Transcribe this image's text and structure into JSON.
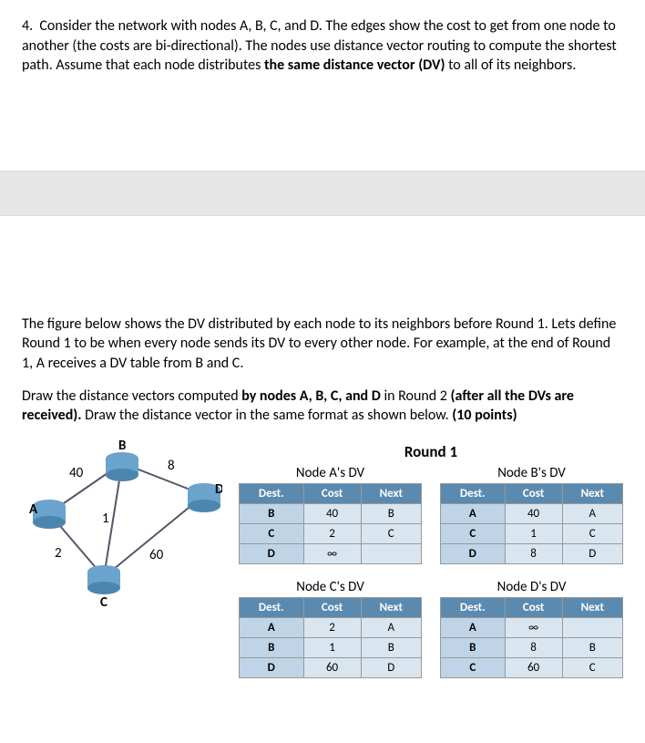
{
  "q_num": "4.",
  "q_p1a": "Consider the network with nodes A, B, C, and D. The edges show the cost to get from one node to another (the costs are bi-directional). The nodes use distance vector routing to compute the shortest path. Assume that each node distributes ",
  "q_p1b": "the same distance vector (DV)",
  "q_p1c": " to all of its neighbors.",
  "q_p2": "The figure below shows the DV distributed by each node to its neighbors before Round 1. Lets define Round 1 to be when every node sends its DV to every other node. For example, at the end of Round 1, A receives a DV table from B and C.",
  "q_p3a": "Draw the distance vectors computed ",
  "q_p3b": "by nodes A, B, C, and D",
  "q_p3c": " in Round 2 ",
  "q_p3d": "(after all the DVs are received).",
  "q_p3e": " Draw the distance vector in the same format as shown below. ",
  "q_p3f": "(10 points)",
  "round_title": "Round 1",
  "headers": {
    "dest": "Dest.",
    "cost": "Cost",
    "next": "Next"
  },
  "graph": {
    "labels": {
      "A": "A",
      "B": "B",
      "C": "C",
      "D": "D"
    },
    "weights": {
      "AB": "40",
      "BD": "8",
      "AC": "2",
      "BC": "1",
      "CD": "60"
    }
  },
  "tables": {
    "A": {
      "title": "Node A's DV",
      "rows": [
        {
          "dest": "B",
          "cost": "40",
          "next": "B"
        },
        {
          "dest": "C",
          "cost": "2",
          "next": "C"
        },
        {
          "dest": "D",
          "cost": "∞",
          "next": ""
        }
      ]
    },
    "B": {
      "title": "Node B's DV",
      "rows": [
        {
          "dest": "A",
          "cost": "40",
          "next": "A"
        },
        {
          "dest": "C",
          "cost": "1",
          "next": "C"
        },
        {
          "dest": "D",
          "cost": "8",
          "next": "D"
        }
      ]
    },
    "C": {
      "title": "Node C's DV",
      "rows": [
        {
          "dest": "A",
          "cost": "2",
          "next": "A"
        },
        {
          "dest": "B",
          "cost": "1",
          "next": "B"
        },
        {
          "dest": "D",
          "cost": "60",
          "next": "D"
        }
      ]
    },
    "D": {
      "title": "Node D's DV",
      "rows": [
        {
          "dest": "A",
          "cost": "∞",
          "next": ""
        },
        {
          "dest": "B",
          "cost": "8",
          "next": "B"
        },
        {
          "dest": "C",
          "cost": "60",
          "next": "C"
        }
      ]
    }
  }
}
